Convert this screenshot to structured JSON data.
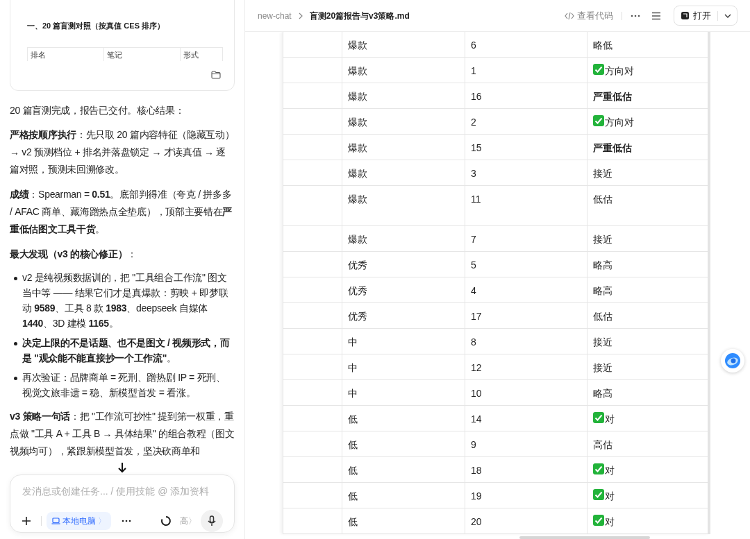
{
  "chat": {
    "card": {
      "heading": "一、20 篇盲测对照（按真值 CES 排序）",
      "columns": [
        "排名",
        "笔记",
        "形式"
      ]
    },
    "intro": "20 篇盲测完成，报告已交付。核心结果：",
    "paragraphs": [
      {
        "kind": "para",
        "text": "**严格按顺序执行**：先只取 20 篇内容特征（隐藏互动）→ v2 预测档位 + 排名并落盘锁定 → 才读真值 → 逐篇对照，预测未回溯修改。"
      },
      {
        "kind": "para",
        "text": "**成绩**：Spearman = **0.51**。底部判得准（夸克 / 拼多多 / AFAC 商单、藏海蹭热点全垫底），顶部主要错在**严重低估图文工具干货**。"
      },
      {
        "kind": "para",
        "text": "**最大发现（v3 的核心修正）**："
      },
      {
        "kind": "bullets",
        "items": [
          "v2 是纯视频数据训的，把 \"工具组合工作流\" 图文当中等 —— 结果它们才是真爆款：剪映 + 即梦联动 **9589**、工具 8 款 **1983**、deepseek 自媒体 **1440**、3D 建模 **1165**。",
          "**决定上限的不是话题、也不是图文 / 视频形式，而是 \"观众能不能直接抄一个工作流\"**。",
          "再次验证：品牌商单 = 死刑、蹭热剧 IP = 死刑、视觉文旅非遗 = 稳、新模型首发 = 看涨。"
        ]
      },
      {
        "kind": "para",
        "text": "**v3 策略一句话**：把 \"工作流可抄性\" 提到第一权重，重点做 \"工具 A + 工具 B → 具体结果\" 的组合教程（图文视频均可），紧跟新模型首发，坚决砍商单和"
      }
    ],
    "composer": {
      "placeholder": "发消息或创建任务... / 使用技能 @ 添加资料",
      "device": "本地电脑",
      "device_caret": "〉",
      "level_label": "高",
      "level_caret": "〉"
    }
  },
  "doc": {
    "breadcrumb": [
      "new-chat",
      "盲测20篇报告与v3策略.md"
    ],
    "view_code": "查看代码",
    "open": "打开",
    "rows": [
      {
        "tier": "爆款",
        "rank": "6",
        "verdict": "略低",
        "kind": "plain"
      },
      {
        "tier": "爆款",
        "rank": "1",
        "verdict": "方向对",
        "kind": "check"
      },
      {
        "tier": "爆款",
        "rank": "16",
        "verdict": "严重低估",
        "kind": "bold"
      },
      {
        "tier": "爆款",
        "rank": "2",
        "verdict": "方向对",
        "kind": "check"
      },
      {
        "tier": "爆款",
        "rank": "15",
        "verdict": "严重低估",
        "kind": "bold"
      },
      {
        "tier": "爆款",
        "rank": "3",
        "verdict": "接近",
        "kind": "plain"
      },
      {
        "tier": "爆款",
        "rank": "11",
        "verdict": "低估",
        "kind": "plain"
      },
      {
        "tier": "爆款",
        "rank": "7",
        "verdict": "接近",
        "kind": "plain"
      },
      {
        "tier": "优秀",
        "rank": "5",
        "verdict": "略高",
        "kind": "plain"
      },
      {
        "tier": "优秀",
        "rank": "4",
        "verdict": "略高",
        "kind": "plain"
      },
      {
        "tier": "优秀",
        "rank": "17",
        "verdict": "低估",
        "kind": "plain"
      },
      {
        "tier": "中",
        "rank": "8",
        "verdict": "接近",
        "kind": "plain"
      },
      {
        "tier": "中",
        "rank": "12",
        "verdict": "接近",
        "kind": "plain"
      },
      {
        "tier": "中",
        "rank": "10",
        "verdict": "略高",
        "kind": "plain"
      },
      {
        "tier": "低",
        "rank": "14",
        "verdict": "对",
        "kind": "check"
      },
      {
        "tier": "低",
        "rank": "9",
        "verdict": "高估",
        "kind": "plain"
      },
      {
        "tier": "低",
        "rank": "18",
        "verdict": "对",
        "kind": "check"
      },
      {
        "tier": "低",
        "rank": "19",
        "verdict": "对",
        "kind": "check"
      },
      {
        "tier": "低",
        "rank": "20",
        "verdict": "对",
        "kind": "check"
      }
    ]
  }
}
